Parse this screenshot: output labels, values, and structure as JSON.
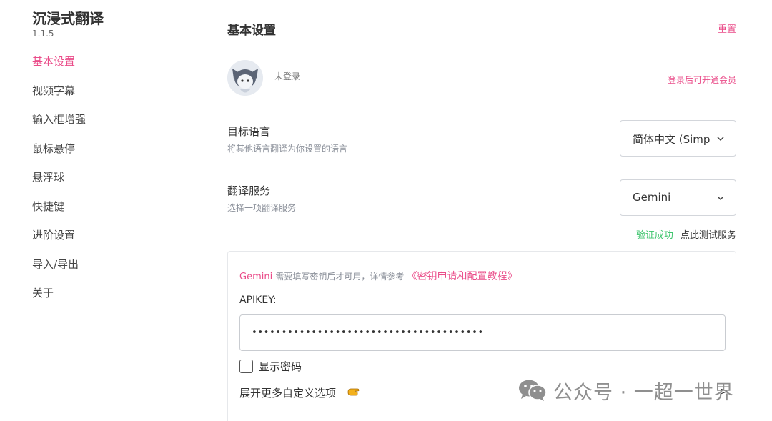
{
  "app": {
    "title": "沉浸式翻译",
    "version": "1.1.5"
  },
  "sidebar": {
    "items": [
      {
        "label": "基本设置",
        "active": true
      },
      {
        "label": "视频字幕"
      },
      {
        "label": "输入框增强"
      },
      {
        "label": "鼠标悬停"
      },
      {
        "label": "悬浮球"
      },
      {
        "label": "快捷键"
      },
      {
        "label": "进阶设置"
      },
      {
        "label": "导入/导出"
      },
      {
        "label": "关于"
      }
    ]
  },
  "header": {
    "title": "基本设置",
    "reset_label": "重置"
  },
  "account": {
    "status": "未登录",
    "member_link": "登录后可开通会员"
  },
  "target_language": {
    "label": "目标语言",
    "description": "将其他语言翻译为你设置的语言",
    "selected": "简体中文 (Simplified Chinese)"
  },
  "translate_service": {
    "label": "翻译服务",
    "description": "选择一项翻译服务",
    "selected": "Gemini",
    "verify_status": "验证成功",
    "test_link": "点此测试服务"
  },
  "service_card": {
    "service_name": "Gemini",
    "note": "需要填写密钥后才可用，详情参考",
    "tutorial_link": "《密钥申请和配置教程》",
    "apikey_label": "APIKEY:",
    "apikey_value": "•••••••••••••••••••••••••••••••••••••••",
    "show_password_label": "显示密码",
    "more_options_label": "展开更多自定义选项",
    "expand_arrow": ">"
  },
  "watermark": {
    "text": "公众号 · 一超一世界"
  },
  "colors": {
    "accent": "#ea4c89",
    "success": "#3ec46d",
    "muted": "#8a8f99"
  }
}
